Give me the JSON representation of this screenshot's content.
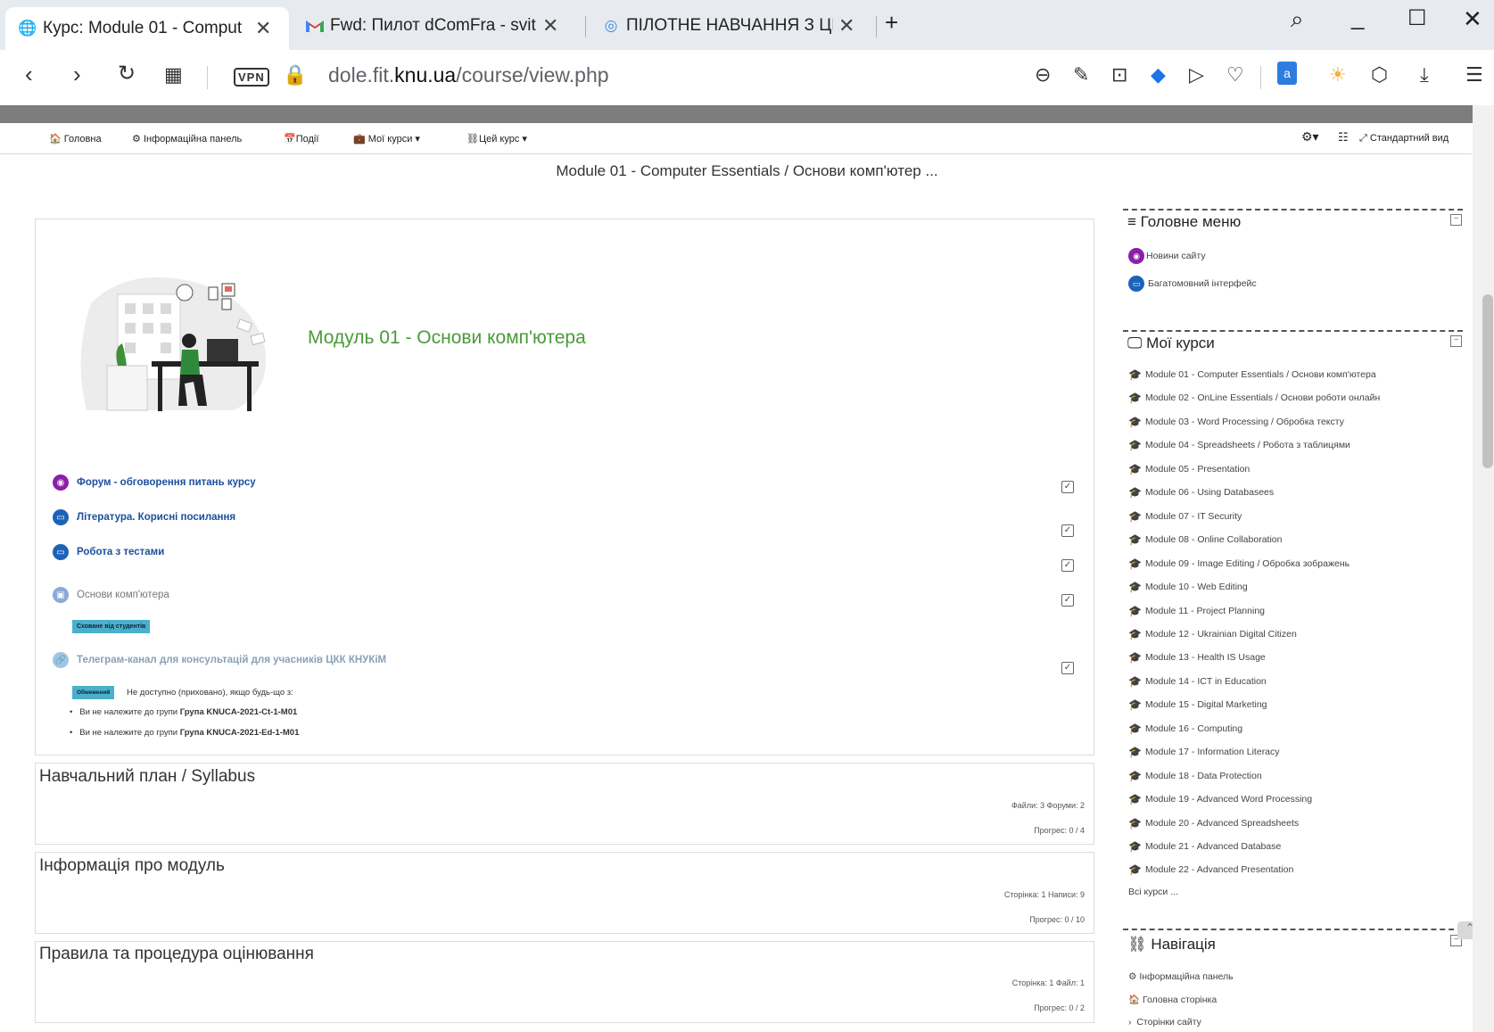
{
  "browser": {
    "tabs": [
      {
        "title": "Курс: Module 01 - Comput",
        "icon": "moodle-globe-icon"
      },
      {
        "title": "Fwd: Пилот dComFra - svit",
        "icon": "gmail-icon"
      },
      {
        "title": "ПІЛОТНЕ НАВЧАННЯ З ЦИ",
        "icon": "swirl-icon"
      }
    ],
    "vpn_label": "VPN",
    "url_prefix": "dole.fit.",
    "url_domain": "knu.ua",
    "url_path": "/course/view.php",
    "download_badge": "-1"
  },
  "moodle_nav": {
    "home": "Головна",
    "dashboard": "Інформаційна панель",
    "events": "Події",
    "my_courses": "Мої курси",
    "this_course": "Цей курс",
    "standard_view": "Стандартний вид"
  },
  "breadcrumb": "Module 01 - Computer Essentials / Основи комп'ютер ...",
  "course": {
    "title": "Модуль 01 - Основи комп'ютера",
    "activities": [
      {
        "label": "Форум - обговорення питань курсу",
        "color": "#8c1fa8",
        "style": "link"
      },
      {
        "label": "Література. Корисні посилання",
        "color": "#1b63b8",
        "style": "link"
      },
      {
        "label": "Робота з тестами",
        "color": "#1b63b8",
        "style": "link"
      },
      {
        "label": "Основи комп'ютера",
        "color": "#8ba8d8",
        "style": "dim"
      },
      {
        "label": "Телеграм-канал для консультацій для учасників ЦКК КНУКіМ",
        "color": "#9ec6e4",
        "style": "dim"
      }
    ],
    "hidden_badge": "Сховане від студентів",
    "restricted_badge": "Обмежений",
    "restricted_text": "Не доступно (приховано), якщо будь-що з:",
    "restrictions": [
      {
        "prefix": "Ви не належите до групи",
        "group": "Група KNUCA-2021-Ct-1-M01"
      },
      {
        "prefix": "Ви не належите до групи",
        "group": "Група KNUCA-2021-Ed-1-M01"
      }
    ]
  },
  "sections": [
    {
      "title": "Навчальний план / Syllabus",
      "stats": "Файли: 3  Форуми: 2",
      "progress": "Прогрес: 0 / 4"
    },
    {
      "title": "Інформація про модуль",
      "stats": "Сторінка: 1  Написи: 9",
      "progress": "Прогрес: 0 / 10"
    },
    {
      "title": "Правила та процедура оцінювання",
      "stats": "Сторінка: 1  Файл: 1",
      "progress": "Прогрес: 0 / 2"
    }
  ],
  "main_menu": {
    "title": "Головне меню",
    "items": [
      "Новини сайту",
      "Багатомовний інтерфейс"
    ]
  },
  "my_courses": {
    "title": "Мої курси",
    "items": [
      "Module 01 - Computer Essentials / Основи комп'ютера",
      "Module 02 - OnLine Essentials / Основи роботи онлайн",
      "Module 03 - Word Processing / Обробка тексту",
      "Module 04 - Spreadsheets / Робота з таблицями",
      "Module 05 - Presentation",
      "Module 06 - Using Databasees",
      "Module 07 - IT Security",
      "Module 08 - Online Collaboration",
      "Module 09 - Image Editing / Обробка зображень",
      "Module 10 - Web Editing",
      "Module 11 - Project Planning",
      "Module 12 - Ukrainian Digital Citizen",
      "Module 13 - Health IS Usage",
      "Module 14 - ICT in Education",
      "Module 15 - Digital Marketing",
      "Module 16 - Computing",
      "Module 17 - Information Literacy",
      "Module 18 - Data Protection",
      "Module 19 - Advanced Word Processing",
      "Module 20 - Advanced Spreadsheets",
      "Module 21 - Advanced Database",
      "Module 22 - Advanced Presentation"
    ],
    "all_courses": "Всі курси ..."
  },
  "navigation": {
    "title": "Навігація",
    "items": [
      "Інформаційна панель",
      "Головна сторінка",
      "Сторінки сайту"
    ]
  }
}
